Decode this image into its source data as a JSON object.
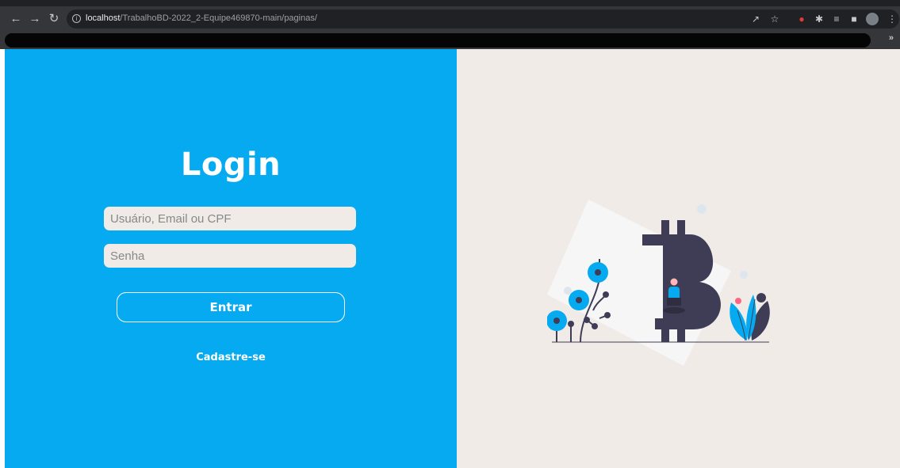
{
  "browser": {
    "back_icon": "arrow-left-icon",
    "forward_icon": "arrow-right-icon",
    "reload_icon": "reload-icon",
    "url_host": "localhost",
    "url_path": "/TrabalhoBD-2022_2-Equipe469870-main/paginas/",
    "more_bookmarks": "»"
  },
  "login": {
    "title": "Login",
    "username_placeholder": "Usuário, Email ou CPF",
    "password_placeholder": "Senha",
    "submit_label": "Entrar",
    "register_link": "Cadastre-se"
  },
  "illustration": {
    "coin_symbol": "₿"
  },
  "colors": {
    "primary": "#05aaf0",
    "right_background": "#f0ebe7",
    "input_background": "#f0ebe7",
    "bitcoin_dark": "#3f3d56"
  }
}
